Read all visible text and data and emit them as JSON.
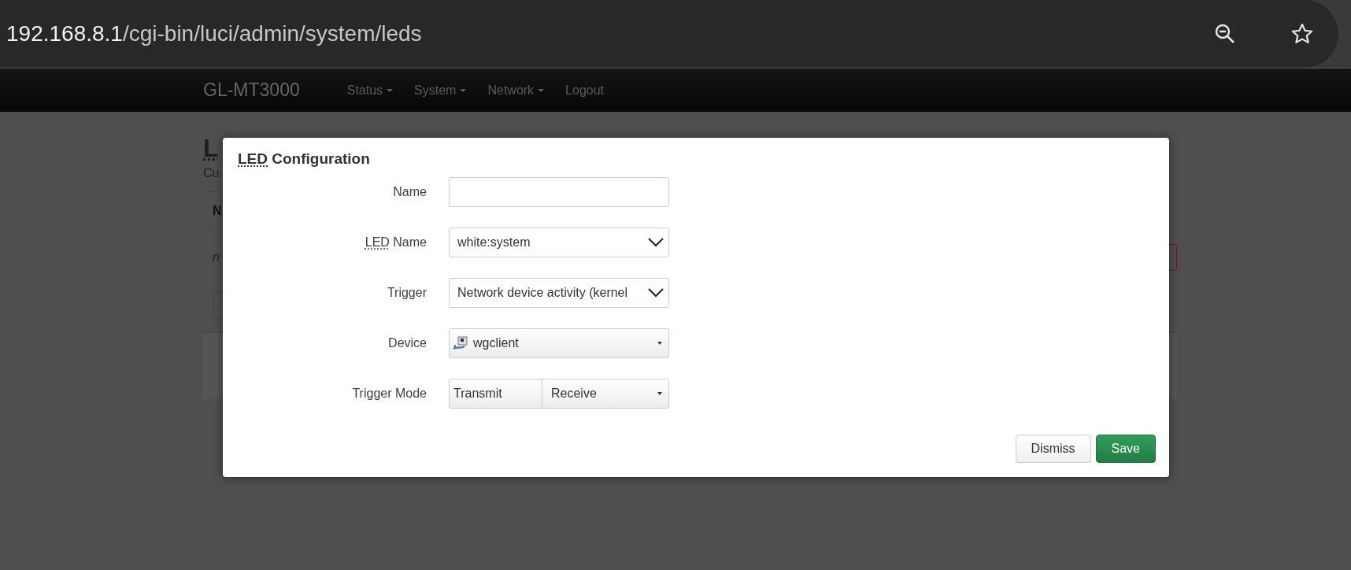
{
  "browser": {
    "url_host": "192.168.8.1",
    "url_path": "/cgi-bin/luci/admin/system/leds"
  },
  "navbar": {
    "brand": "GL-MT3000",
    "items": [
      {
        "label": "Status",
        "dropdown": true
      },
      {
        "label": "System",
        "dropdown": true
      },
      {
        "label": "Network",
        "dropdown": true
      },
      {
        "label": "Logout",
        "dropdown": false
      }
    ]
  },
  "background_page": {
    "heading": "L",
    "description": "Cu",
    "table_header": "N",
    "empty_row": "n"
  },
  "modal": {
    "title_abbr": "LED",
    "title": "Configuration",
    "fields": [
      {
        "kind": "text",
        "label": "Name"
      },
      {
        "kind": "select",
        "abbr": "LED",
        "label": "Name",
        "value": "white:system"
      },
      {
        "kind": "select",
        "label": "Trigger",
        "value": "Network device activity (kernel"
      },
      {
        "kind": "device",
        "label": "Device",
        "value": "wgclient"
      },
      {
        "kind": "multi",
        "label": "Trigger Mode",
        "values": [
          "Transmit",
          "Receive"
        ]
      }
    ],
    "buttons": [
      {
        "label": "Dismiss",
        "kind": "neutral"
      },
      {
        "label": "Save",
        "kind": "primary"
      }
    ]
  }
}
